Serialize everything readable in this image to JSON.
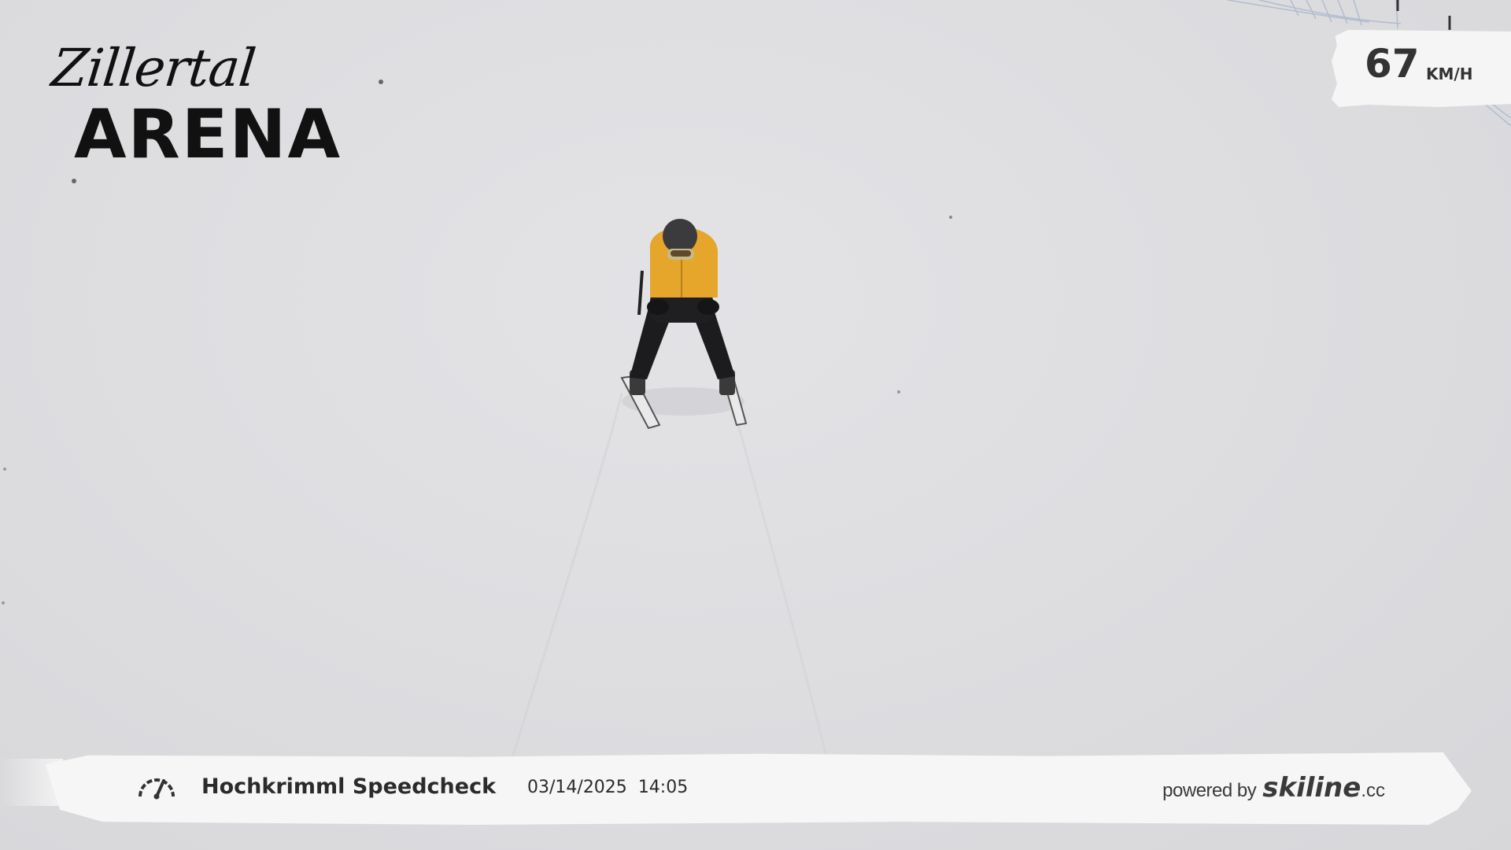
{
  "logo": {
    "script_text": "Zillertal",
    "main_text": "ARENA"
  },
  "speed": {
    "value": "67",
    "unit": "KM/H"
  },
  "banner": {
    "gauge_icon": "speedometer-icon",
    "location": "Hochkrimml Speedcheck",
    "date": "03/14/2025",
    "time": "14:05",
    "powered_by": "powered by",
    "brand": "skiline",
    "brand_tld": ".cc"
  },
  "colors": {
    "snow": "#dedee1",
    "jacket": "#e8a62a",
    "text_dark": "#2b2b2b",
    "badge_bg": "#f5f5f5"
  }
}
